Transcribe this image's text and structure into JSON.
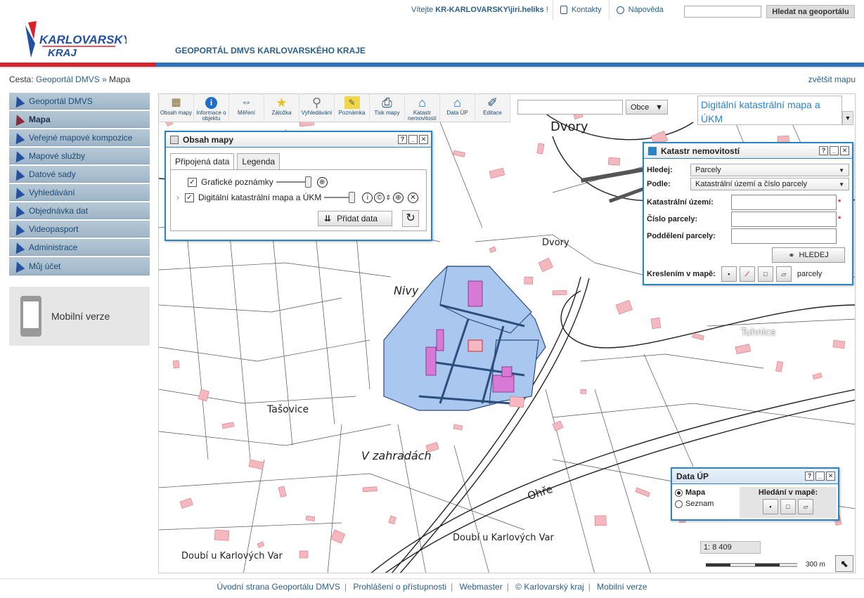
{
  "header": {
    "logo_line1": "KARLOVARSKÝ",
    "logo_line2": "KRAJ",
    "portal_title": "GEOPORTÁL DMVS KARLOVARSKÉHO KRAJE",
    "welcome": "Vítejte",
    "user": "KR-KARLOVARSKY\\jiri.heliks",
    "welcome_end": "!",
    "contacts": "Kontakty",
    "help": "Nápověda",
    "search_button": "Hledat na geoportálu",
    "search_value": ""
  },
  "breadcrumb": {
    "label": "Cesta:",
    "items": [
      "Geoportál DMVS",
      "Mapa"
    ],
    "sep": "»"
  },
  "enlarge_map": "zvětšit mapu",
  "sidebar": {
    "items": [
      {
        "label": "Geoportál DMVS"
      },
      {
        "label": "Mapa",
        "active": true
      },
      {
        "label": "Veřejné mapové kompozice"
      },
      {
        "label": "Mapové služby"
      },
      {
        "label": "Datové sady"
      },
      {
        "label": "Vyhledávání"
      },
      {
        "label": "Objednávka dat"
      },
      {
        "label": "Videopasport"
      },
      {
        "label": "Administrace"
      },
      {
        "label": "Můj účet"
      }
    ],
    "mobile": "Mobilní verze"
  },
  "toolbar": {
    "items": [
      {
        "label": "Obsah mapy",
        "icon": "layers-icon",
        "glyph": "▦"
      },
      {
        "label": "Informace o objektu",
        "icon": "info-icon",
        "glyph": "i"
      },
      {
        "label": "Měření",
        "icon": "ruler-icon",
        "glyph": "⇔"
      },
      {
        "label": "Záložka",
        "icon": "star-icon",
        "glyph": "★"
      },
      {
        "label": "Vyhledávání",
        "icon": "magnifier-icon",
        "glyph": "⚲"
      },
      {
        "label": "Poznámka",
        "icon": "note-icon",
        "glyph": "✎"
      },
      {
        "label": "Tisk mapy",
        "icon": "printer-icon",
        "glyph": "⎙"
      },
      {
        "label": "Katastr nemovitostí",
        "icon": "cadastre-icon",
        "glyph": "⌂"
      },
      {
        "label": "Data ÚP",
        "icon": "house-icon",
        "glyph": "⌂"
      },
      {
        "label": "Editace",
        "icon": "pencil-icon",
        "glyph": "✐"
      }
    ],
    "obce_value": "",
    "obce_button": "Obce",
    "layer_title": "Digitální katastrální mapa a ÚKM"
  },
  "obsah": {
    "title": "Obsah mapy",
    "tabs": [
      "Připojená data",
      "Legenda"
    ],
    "layers": [
      {
        "label": "Grafické poznámky",
        "checked": true
      },
      {
        "label": "Digitální katastrální mapa a ÚKM",
        "checked": true
      }
    ],
    "add_button": "Přidat data"
  },
  "katastr": {
    "title": "Katastr nemovitostí",
    "hledej_label": "Hledej:",
    "hledej_value": "Parcely",
    "podle_label": "Podle:",
    "podle_value": "Katastrální území a číslo parcely",
    "ku_label": "Katastrální území:",
    "cislo_label": "Číslo parcely:",
    "podd_label": "Poddělení parcely:",
    "search_button": "HLEDEJ",
    "draw_label": "Kreslením v mapě:",
    "draw_suffix": "parcely"
  },
  "dataup": {
    "title": "Data ÚP",
    "options": [
      "Mapa",
      "Seznam"
    ],
    "search_label": "Hledání v mapě:"
  },
  "map": {
    "scale": "1: 8 409",
    "scale_bar_label": "300 m",
    "place_labels": [
      "Dvory",
      "Dvory",
      "Nivy",
      "Tuhnice",
      "Tašovice",
      "V zahradách",
      "Ohře",
      "Doubí u Karlových Var",
      "Doubí u Karlových Var"
    ]
  },
  "footer": {
    "links": [
      "Úvodní strana Geoportálu DMVS",
      "Prohlášení o přístupnosti",
      "Webmaster",
      "© Karlovarský kraj",
      "Mobilní verze"
    ]
  },
  "colors": {
    "accent_blue": "#2b84c5",
    "brand_red": "#d7242d",
    "sidebar_bg": "#b6c8d6",
    "parcel_blue": "#a9c7ef",
    "building_pink": "#f5b8c0"
  }
}
